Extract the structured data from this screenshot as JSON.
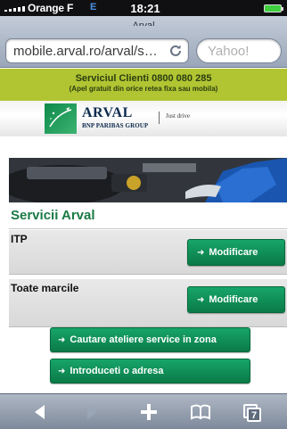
{
  "status_bar": {
    "carrier": "Orange F",
    "network": "E",
    "time": "18:21"
  },
  "browser": {
    "url": "mobile.arval.ro/arval/s…",
    "search_placeholder": "Yahoo!",
    "page_title_sliver": "Arval"
  },
  "call_banner": {
    "title": "Serviciul Clienti 0800 080 285",
    "subtitle": "(Apel gratuit din orice retea fixa sau mobila)"
  },
  "logo": {
    "brand": "ARVAL",
    "group": "BNP PARIBAS GROUP",
    "tagline": "Just drive"
  },
  "section": {
    "title": "Servicii Arval"
  },
  "rows": [
    {
      "label": "ITP",
      "button": "Modificare"
    },
    {
      "label": "Toate marcile",
      "button": "Modificare"
    }
  ],
  "actions": {
    "search_workshops": "Cautare ateliere service in zona",
    "enter_address": "Introduceti o adresa"
  },
  "toolbar": {
    "tab_count": "7"
  }
}
